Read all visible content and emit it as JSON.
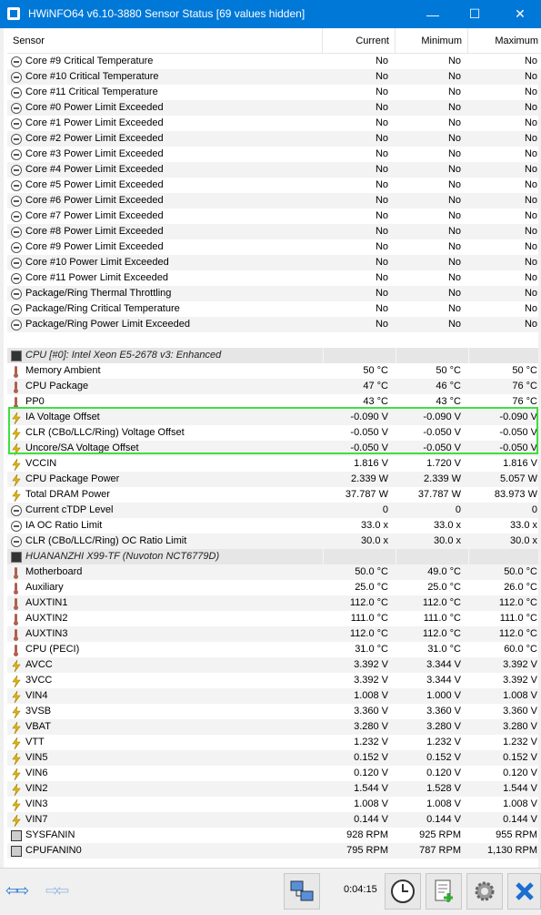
{
  "window": {
    "title": "HWiNFO64 v6.10-3880 Sensor Status [69 values hidden]",
    "controls": {
      "minimize": "—",
      "maximize": "☐",
      "close": "✕"
    }
  },
  "columns": {
    "sensor": "Sensor",
    "current": "Current",
    "minimum": "Minimum",
    "maximum": "Maximum"
  },
  "rows": [
    {
      "icon": "clock",
      "name": "Core #9 Critical Temperature",
      "cur": "No",
      "min": "No",
      "max": "No"
    },
    {
      "icon": "clock",
      "name": "Core #10 Critical Temperature",
      "cur": "No",
      "min": "No",
      "max": "No"
    },
    {
      "icon": "clock",
      "name": "Core #11 Critical Temperature",
      "cur": "No",
      "min": "No",
      "max": "No"
    },
    {
      "icon": "clock",
      "name": "Core #0 Power Limit Exceeded",
      "cur": "No",
      "min": "No",
      "max": "No"
    },
    {
      "icon": "clock",
      "name": "Core #1 Power Limit Exceeded",
      "cur": "No",
      "min": "No",
      "max": "No"
    },
    {
      "icon": "clock",
      "name": "Core #2 Power Limit Exceeded",
      "cur": "No",
      "min": "No",
      "max": "No"
    },
    {
      "icon": "clock",
      "name": "Core #3 Power Limit Exceeded",
      "cur": "No",
      "min": "No",
      "max": "No"
    },
    {
      "icon": "clock",
      "name": "Core #4 Power Limit Exceeded",
      "cur": "No",
      "min": "No",
      "max": "No"
    },
    {
      "icon": "clock",
      "name": "Core #5 Power Limit Exceeded",
      "cur": "No",
      "min": "No",
      "max": "No"
    },
    {
      "icon": "clock",
      "name": "Core #6 Power Limit Exceeded",
      "cur": "No",
      "min": "No",
      "max": "No"
    },
    {
      "icon": "clock",
      "name": "Core #7 Power Limit Exceeded",
      "cur": "No",
      "min": "No",
      "max": "No"
    },
    {
      "icon": "clock",
      "name": "Core #8 Power Limit Exceeded",
      "cur": "No",
      "min": "No",
      "max": "No"
    },
    {
      "icon": "clock",
      "name": "Core #9 Power Limit Exceeded",
      "cur": "No",
      "min": "No",
      "max": "No"
    },
    {
      "icon": "clock",
      "name": "Core #10 Power Limit Exceeded",
      "cur": "No",
      "min": "No",
      "max": "No"
    },
    {
      "icon": "clock",
      "name": "Core #11 Power Limit Exceeded",
      "cur": "No",
      "min": "No",
      "max": "No"
    },
    {
      "icon": "clock",
      "name": "Package/Ring Thermal Throttling",
      "cur": "No",
      "min": "No",
      "max": "No"
    },
    {
      "icon": "clock",
      "name": "Package/Ring Critical Temperature",
      "cur": "No",
      "min": "No",
      "max": "No"
    },
    {
      "icon": "clock",
      "name": "Package/Ring Power Limit Exceeded",
      "cur": "No",
      "min": "No",
      "max": "No"
    },
    {
      "type": "blank"
    },
    {
      "type": "group",
      "icon": "chip",
      "name": "CPU [#0]: Intel Xeon E5-2678 v3: Enhanced"
    },
    {
      "icon": "therm",
      "name": "Memory Ambient",
      "cur": "50 °C",
      "min": "50 °C",
      "max": "50 °C"
    },
    {
      "icon": "therm",
      "name": "CPU Package",
      "cur": "47 °C",
      "min": "46 °C",
      "max": "76 °C"
    },
    {
      "icon": "therm",
      "name": "PP0",
      "cur": "43 °C",
      "min": "43 °C",
      "max": "76 °C"
    },
    {
      "icon": "bolt",
      "name": "IA Voltage Offset",
      "cur": "-0.090 V",
      "min": "-0.090 V",
      "max": "-0.090 V"
    },
    {
      "icon": "bolt",
      "name": "CLR (CBo/LLC/Ring) Voltage Offset",
      "cur": "-0.050 V",
      "min": "-0.050 V",
      "max": "-0.050 V"
    },
    {
      "icon": "bolt",
      "name": "Uncore/SA Voltage Offset",
      "cur": "-0.050 V",
      "min": "-0.050 V",
      "max": "-0.050 V"
    },
    {
      "icon": "bolt",
      "name": "VCCIN",
      "cur": "1.816 V",
      "min": "1.720 V",
      "max": "1.816 V"
    },
    {
      "icon": "bolt",
      "name": "CPU Package Power",
      "cur": "2.339 W",
      "min": "2.339 W",
      "max": "5.057 W"
    },
    {
      "icon": "bolt",
      "name": "Total DRAM Power",
      "cur": "37.787 W",
      "min": "37.787 W",
      "max": "83.973 W"
    },
    {
      "icon": "clock",
      "name": "Current cTDP Level",
      "cur": "0",
      "min": "0",
      "max": "0"
    },
    {
      "icon": "clock",
      "name": "IA OC Ratio Limit",
      "cur": "33.0 x",
      "min": "33.0 x",
      "max": "33.0 x"
    },
    {
      "icon": "clock",
      "name": "CLR (CBo/LLC/Ring) OC Ratio Limit",
      "cur": "30.0 x",
      "min": "30.0 x",
      "max": "30.0 x"
    },
    {
      "type": "group",
      "icon": "chip",
      "name": "HUANANZHI X99-TF (Nuvoton NCT6779D)"
    },
    {
      "icon": "therm",
      "name": "Motherboard",
      "cur": "50.0 °C",
      "min": "49.0 °C",
      "max": "50.0 °C"
    },
    {
      "icon": "therm",
      "name": "Auxiliary",
      "cur": "25.0 °C",
      "min": "25.0 °C",
      "max": "26.0 °C"
    },
    {
      "icon": "therm",
      "name": "AUXTIN1",
      "cur": "112.0 °C",
      "min": "112.0 °C",
      "max": "112.0 °C"
    },
    {
      "icon": "therm",
      "name": "AUXTIN2",
      "cur": "111.0 °C",
      "min": "111.0 °C",
      "max": "111.0 °C"
    },
    {
      "icon": "therm",
      "name": "AUXTIN3",
      "cur": "112.0 °C",
      "min": "112.0 °C",
      "max": "112.0 °C"
    },
    {
      "icon": "therm",
      "name": "CPU (PECI)",
      "cur": "31.0 °C",
      "min": "31.0 °C",
      "max": "60.0 °C"
    },
    {
      "icon": "bolt",
      "name": "AVCC",
      "cur": "3.392 V",
      "min": "3.344 V",
      "max": "3.392 V"
    },
    {
      "icon": "bolt",
      "name": "3VCC",
      "cur": "3.392 V",
      "min": "3.344 V",
      "max": "3.392 V"
    },
    {
      "icon": "bolt",
      "name": "VIN4",
      "cur": "1.008 V",
      "min": "1.000 V",
      "max": "1.008 V"
    },
    {
      "icon": "bolt",
      "name": "3VSB",
      "cur": "3.360 V",
      "min": "3.360 V",
      "max": "3.360 V"
    },
    {
      "icon": "bolt",
      "name": "VBAT",
      "cur": "3.280 V",
      "min": "3.280 V",
      "max": "3.280 V"
    },
    {
      "icon": "bolt",
      "name": "VTT",
      "cur": "1.232 V",
      "min": "1.232 V",
      "max": "1.232 V"
    },
    {
      "icon": "bolt",
      "name": "VIN5",
      "cur": "0.152 V",
      "min": "0.152 V",
      "max": "0.152 V"
    },
    {
      "icon": "bolt",
      "name": "VIN6",
      "cur": "0.120 V",
      "min": "0.120 V",
      "max": "0.120 V"
    },
    {
      "icon": "bolt",
      "name": "VIN2",
      "cur": "1.544 V",
      "min": "1.528 V",
      "max": "1.544 V"
    },
    {
      "icon": "bolt",
      "name": "VIN3",
      "cur": "1.008 V",
      "min": "1.008 V",
      "max": "1.008 V"
    },
    {
      "icon": "bolt",
      "name": "VIN7",
      "cur": "0.144 V",
      "min": "0.144 V",
      "max": "0.144 V"
    },
    {
      "icon": "fan",
      "name": "SYSFANIN",
      "cur": "928 RPM",
      "min": "925 RPM",
      "max": "955 RPM"
    },
    {
      "icon": "fan",
      "name": "CPUFANIN0",
      "cur": "795 RPM",
      "min": "787 RPM",
      "max": "1,130 RPM"
    }
  ],
  "toolbar": {
    "elapsed": "0:04:15",
    "nav_left": "⇦⇨",
    "nav_right": "⇨⇦",
    "icons": [
      "network-icon",
      "clock-icon",
      "report-add-icon",
      "settings-gear-icon",
      "close-x-icon"
    ]
  },
  "colors": {
    "titlebar": "#0078d7",
    "highlight": "#3ee03e",
    "bolt": "#e8b800",
    "nav_arrow": "#2a7ad4",
    "close_x": "#1b6fd1",
    "report_add": "#2fb02f"
  }
}
